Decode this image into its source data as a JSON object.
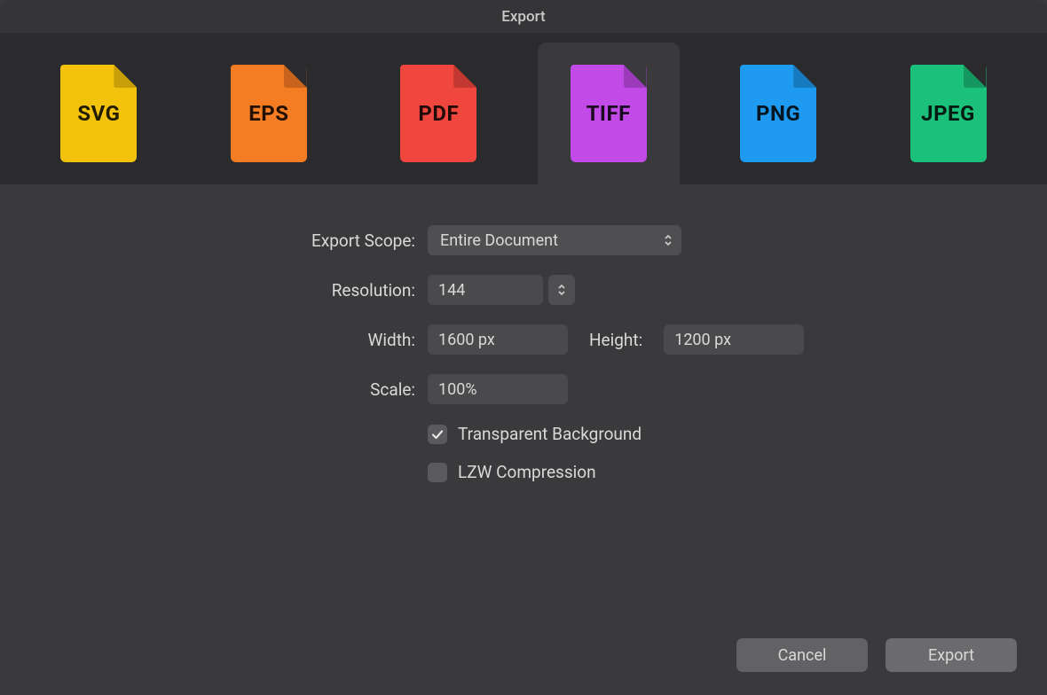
{
  "title": "Export",
  "tabs": [
    {
      "label": "SVG",
      "color": "#F2C20C",
      "fold": "#C99F09"
    },
    {
      "label": "EPS",
      "color": "#F47C22",
      "fold": "#C9631B"
    },
    {
      "label": "PDF",
      "color": "#EF463E",
      "fold": "#C33931"
    },
    {
      "label": "TIFF",
      "color": "#C24BE8",
      "fold": "#9C3BBA"
    },
    {
      "label": "PNG",
      "color": "#1E9BF0",
      "fold": "#177BC0"
    },
    {
      "label": "JPEG",
      "color": "#1BC07A",
      "fold": "#149760"
    }
  ],
  "selected_tab_index": 3,
  "form": {
    "export_scope_label": "Export Scope:",
    "export_scope_value": "Entire Document",
    "resolution_label": "Resolution:",
    "resolution_value": "144",
    "width_label": "Width:",
    "width_value": "1600 px",
    "height_label": "Height:",
    "height_value": "1200 px",
    "scale_label": "Scale:",
    "scale_value": "100%",
    "transparent_bg_label": "Transparent Background",
    "transparent_bg_checked": true,
    "lzw_label": "LZW Compression",
    "lzw_checked": false
  },
  "buttons": {
    "cancel": "Cancel",
    "export": "Export"
  }
}
